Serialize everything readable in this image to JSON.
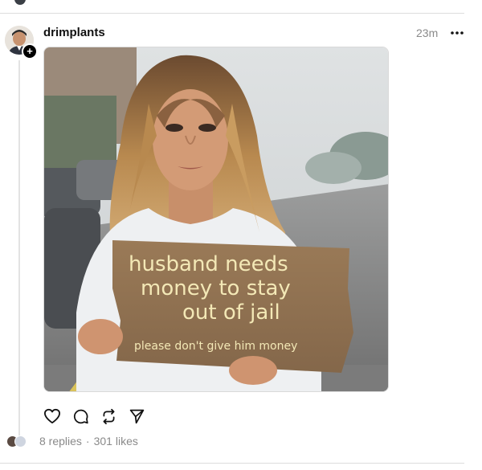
{
  "post": {
    "username": "drimplants",
    "timestamp": "23m",
    "more_icon": "ellipsis-icon",
    "follow_icon": "plus-icon",
    "image": {
      "sign_lines": [
        "husband needs",
        "money to stay",
        "out of jail",
        "please don't give him money"
      ]
    },
    "actions": {
      "like_icon": "heart-icon",
      "reply_icon": "comment-icon",
      "repost_icon": "repost-icon",
      "share_icon": "send-icon"
    },
    "stats": {
      "replies": "8 replies",
      "separator": "·",
      "likes": "301 likes"
    }
  }
}
